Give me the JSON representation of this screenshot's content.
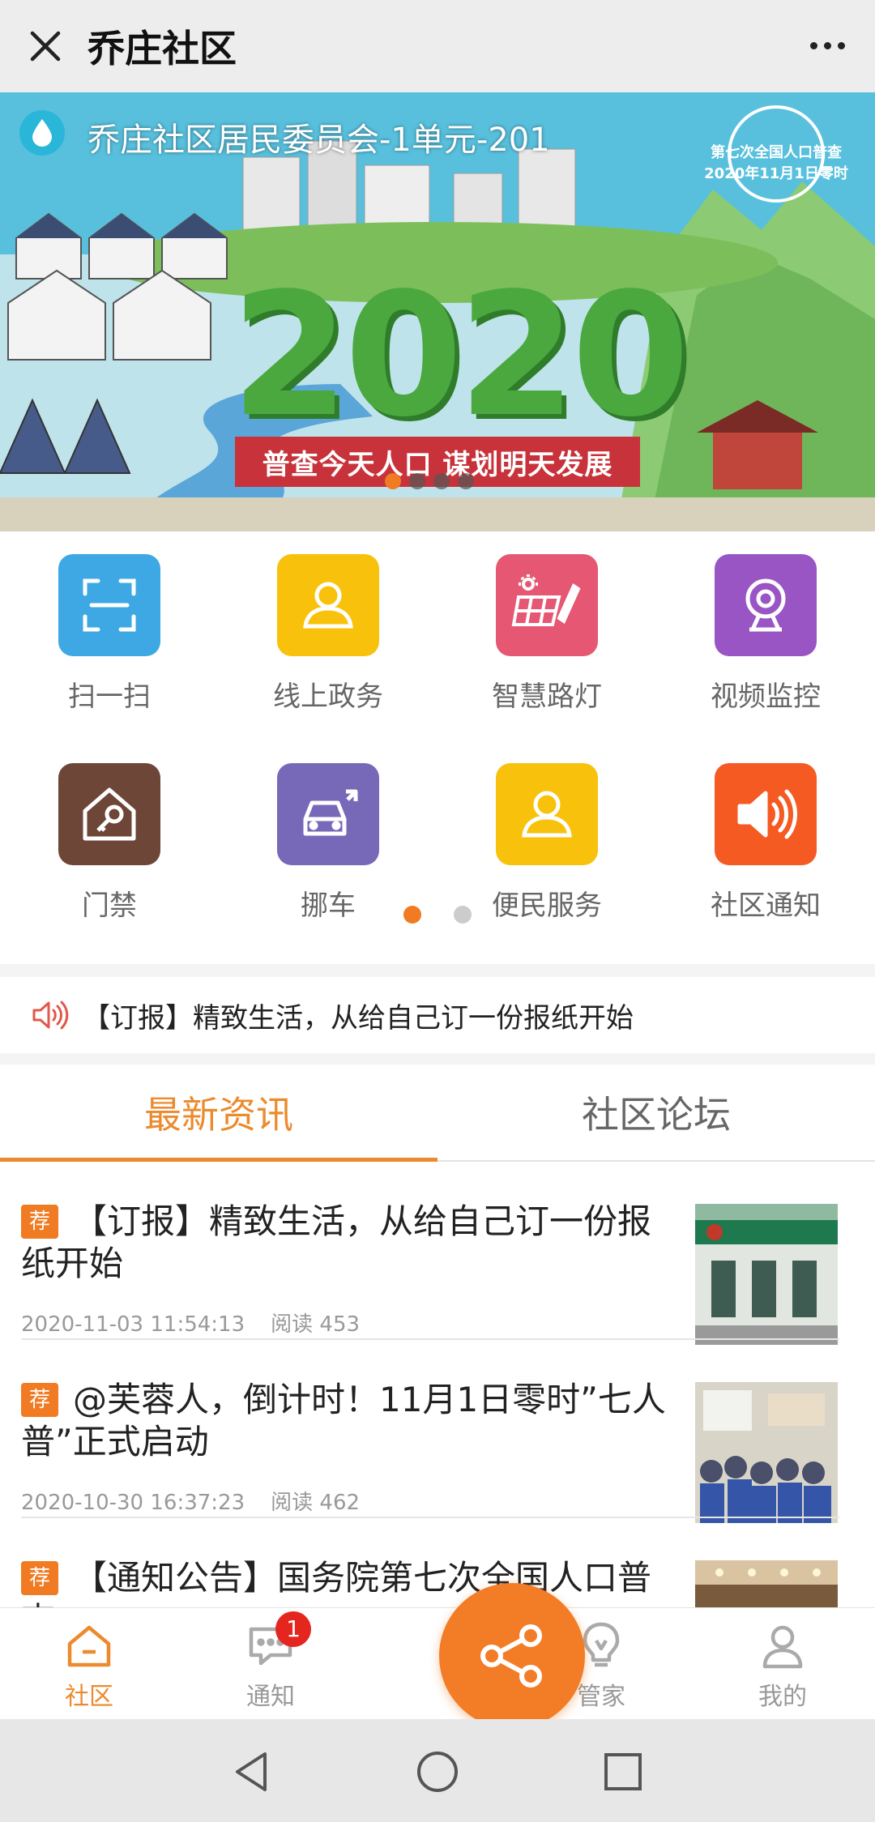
{
  "header": {
    "title": "乔庄社区",
    "close_icon": "close-icon",
    "more_icon": "more-icon"
  },
  "banner": {
    "location": "乔庄社区居民委员会-1单元-201",
    "year": "2020",
    "slogan": "普查今天人口 谋划明天发展",
    "badge_line1": "第七次全国人口普查",
    "badge_line2": "2020年11月1日零时",
    "slide_count": 4,
    "active_slide": 0
  },
  "services": {
    "items": [
      {
        "label": "扫一扫",
        "icon": "scan-icon",
        "color": "#3ea8e5"
      },
      {
        "label": "线上政务",
        "icon": "person-icon",
        "color": "#f8c20c"
      },
      {
        "label": "智慧路灯",
        "icon": "solar-panel-icon",
        "color": "#e65773"
      },
      {
        "label": "视频监控",
        "icon": "webcam-icon",
        "color": "#9a55c5"
      },
      {
        "label": "门禁",
        "icon": "house-key-icon",
        "color": "#6e4637"
      },
      {
        "label": "挪车",
        "icon": "move-car-icon",
        "color": "#7869b8"
      },
      {
        "label": "便民服务",
        "icon": "person-icon",
        "color": "#f8c20c"
      },
      {
        "label": "社区通知",
        "icon": "speaker-icon",
        "color": "#f55a22"
      }
    ],
    "page_count": 2,
    "active_page": 0
  },
  "notice": {
    "text": "【订报】精致生活，从给自己订一份报纸开始",
    "icon": "speaker-icon"
  },
  "tabs": {
    "items": [
      {
        "label": "最新资讯",
        "active": true
      },
      {
        "label": "社区论坛",
        "active": false
      }
    ]
  },
  "news": {
    "items": [
      {
        "tag": "荐",
        "title": "【订报】精致生活，从给自己订一份报纸开始",
        "date": "2020-11-03 11:54:13",
        "reads": "阅读 453"
      },
      {
        "tag": "荐",
        "title": "@芙蓉人，倒计时！11月1日零时”七人普”正式启动",
        "date": "2020-10-30 16:37:23",
        "reads": "阅读 462"
      },
      {
        "tag": "荐",
        "title": "【通知公告】国务院第七次全国人口普查",
        "date": "",
        "reads": ""
      }
    ]
  },
  "bottom_nav": {
    "items": [
      {
        "label": "社区",
        "icon": "home-icon",
        "active": true
      },
      {
        "label": "通知",
        "icon": "message-icon",
        "badge": "1"
      },
      {
        "label": "管家",
        "icon": "lightbulb-icon"
      },
      {
        "label": "我的",
        "icon": "user-icon"
      }
    ],
    "fab_icon": "share-icon"
  },
  "colors": {
    "accent": "#ec8a2d",
    "badge_red": "#e5261f",
    "fab": "#f37c26"
  }
}
